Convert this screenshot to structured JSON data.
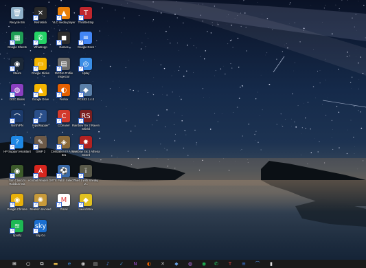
{
  "desktop": {
    "icons": [
      {
        "label": "Recycle Bin",
        "icon": "recycle-bin-icon",
        "color": "#8fb0c8",
        "glyph": "🗑"
      },
      {
        "label": "Retrostick",
        "icon": "retrostick-icon",
        "color": "#2a2a2a",
        "glyph": "✕"
      },
      {
        "label": "VLC media player",
        "icon": "vlc-icon",
        "color": "#e8800a",
        "glyph": "▲"
      },
      {
        "label": "ThrottleStop",
        "icon": "throttlestop-icon",
        "color": "#c0262d",
        "glyph": "T"
      },
      {
        "label": "Google Sheets",
        "icon": "google-sheets-icon",
        "color": "#1f9d55",
        "glyph": "▦"
      },
      {
        "label": "WhatsApp",
        "icon": "whatsapp-icon",
        "color": "#25d366",
        "glyph": "✆"
      },
      {
        "label": "Games",
        "icon": "games-icon",
        "color": "#2c2c2c",
        "glyph": "◼"
      },
      {
        "label": "Google Docs",
        "icon": "google-docs-icon",
        "color": "#4285f4",
        "glyph": "≡"
      },
      {
        "label": "Steam",
        "icon": "steam-icon",
        "color": "#1b2838",
        "glyph": "◉"
      },
      {
        "label": "Google Slides",
        "icon": "google-slides-icon",
        "color": "#f4b400",
        "glyph": "▭"
      },
      {
        "label": "NVIDIA Profile Inspector",
        "icon": "nvidia-profile-inspector-icon",
        "color": "#6b6b6b",
        "glyph": "▤"
      },
      {
        "label": "Uplay",
        "icon": "uplay-icon",
        "color": "#3a8ee6",
        "glyph": "◎"
      },
      {
        "label": "DOC Slides",
        "icon": "doc-slides-icon",
        "color": "#8a3fbf",
        "glyph": "◍"
      },
      {
        "label": "Google Drive",
        "icon": "google-drive-icon",
        "color": "#f4b400",
        "glyph": "▲"
      },
      {
        "label": "Firefox",
        "icon": "firefox-icon",
        "color": "#e66000",
        "glyph": "◐"
      },
      {
        "label": "PCSX2 1.4.0",
        "icon": "pcsx2-icon",
        "color": "#5a7fa8",
        "glyph": "◆"
      },
      {
        "label": "NordVPN",
        "icon": "nordvpn-icon",
        "color": "#1b3a6b",
        "glyph": "⌒"
      },
      {
        "label": "InputMapper",
        "icon": "inputmapper-icon",
        "color": "#2a4f8a",
        "glyph": "♪"
      },
      {
        "label": "CCleaner",
        "icon": "ccleaner-icon",
        "color": "#d33a2c",
        "glyph": "C"
      },
      {
        "label": "Rainbow Six 2 Raven Shield",
        "icon": "raven-shield-icon",
        "color": "#7a1f1f",
        "glyph": "RS"
      },
      {
        "label": "HP Support Assistant",
        "icon": "hp-support-assistant-icon",
        "color": "#1e88e5",
        "glyph": "?"
      },
      {
        "label": "GIMP 2",
        "icon": "gimp-icon",
        "color": "#6d5a48",
        "glyph": "✎"
      },
      {
        "label": "Civilization IV A New Era",
        "icon": "civilization-icon",
        "color": "#8a6a3a",
        "glyph": "◈"
      },
      {
        "label": "Rainbow Six 3 Athena Sword",
        "icon": "athena-sword-icon",
        "color": "#b22222",
        "glyph": "✸"
      },
      {
        "label": "Tom Clancy's Rainbow Six",
        "icon": "rainbow-six-icon",
        "color": "#3c5a2a",
        "glyph": "◉"
      },
      {
        "label": "Acrobat Reader DC",
        "icon": "acrobat-reader-icon",
        "color": "#d7261e",
        "glyph": "A"
      },
      {
        "label": "PTE Patch Selector",
        "icon": "pte-patch-selector-icon",
        "color": "#3a6aa8",
        "glyph": "⚽"
      },
      {
        "label": "Thief 1 with Sneaky U...",
        "icon": "thief-icon",
        "color": "#5a5a4a",
        "glyph": "ї"
      },
      {
        "label": "Google Chrome",
        "icon": "google-chrome-icon",
        "color": "#e8b00a",
        "glyph": "◉"
      },
      {
        "label": "Realism Invoked",
        "icon": "realism-invoked-icon",
        "color": "#c89a3a",
        "glyph": "✺"
      },
      {
        "label": "Gmail",
        "icon": "gmail-icon",
        "color": "#ffffff",
        "glyph": "M"
      },
      {
        "label": "LaunchBox",
        "icon": "launchbox-icon",
        "color": "#e0c020",
        "glyph": "◆"
      },
      {
        "label": "Spotify",
        "icon": "spotify-icon",
        "color": "#1db954",
        "glyph": "≋"
      },
      {
        "label": "Sky Go",
        "icon": "sky-go-icon",
        "color": "#1a6fd1",
        "glyph": "sky"
      }
    ]
  },
  "taskbar": {
    "items": [
      {
        "name": "start-button-windows-icon",
        "glyph": "⊞",
        "color": "#ffffff"
      },
      {
        "name": "search-icon",
        "glyph": "○",
        "color": "#ffffff"
      },
      {
        "name": "task-view-icon",
        "glyph": "⧉",
        "color": "#ffffff"
      },
      {
        "name": "file-explorer-icon",
        "glyph": "▬",
        "color": "#e6b94a"
      },
      {
        "name": "edge-icon",
        "glyph": "e",
        "color": "#3c8ce0"
      },
      {
        "name": "steam-taskbar-icon",
        "glyph": "◉",
        "color": "#cccccc"
      },
      {
        "name": "nvidia-taskbar-icon",
        "glyph": "▤",
        "color": "#aaaaaa"
      },
      {
        "name": "inputmapper-taskbar-icon",
        "glyph": "♪",
        "color": "#4a7ad0"
      },
      {
        "name": "checkmark-app-icon",
        "glyph": "✓",
        "color": "#4a9ae0"
      },
      {
        "name": "onenote-icon",
        "glyph": "N",
        "color": "#9b4ac8"
      },
      {
        "name": "firefox-taskbar-icon",
        "glyph": "◐",
        "color": "#e66000"
      },
      {
        "name": "retrostick-taskbar-icon",
        "glyph": "✕",
        "color": "#bbbbbb"
      },
      {
        "name": "pcsx2-taskbar-icon",
        "glyph": "◆",
        "color": "#6aa0e0"
      },
      {
        "name": "doc-slides-taskbar-icon",
        "glyph": "◍",
        "color": "#b070e0"
      },
      {
        "name": "spotify-taskbar-icon",
        "glyph": "◉",
        "color": "#1db954"
      },
      {
        "name": "whatsapp-taskbar-icon",
        "glyph": "✆",
        "color": "#25d366"
      },
      {
        "name": "throttlestop-taskbar-icon",
        "glyph": "T",
        "color": "#e04040"
      },
      {
        "name": "docs-taskbar-icon",
        "glyph": "≡",
        "color": "#4285f4"
      },
      {
        "name": "nordvpn-taskbar-icon",
        "glyph": "⌒",
        "color": "#4a8ae0"
      },
      {
        "name": "notepad-taskbar-icon",
        "glyph": "▮",
        "color": "#dddddd"
      }
    ]
  }
}
